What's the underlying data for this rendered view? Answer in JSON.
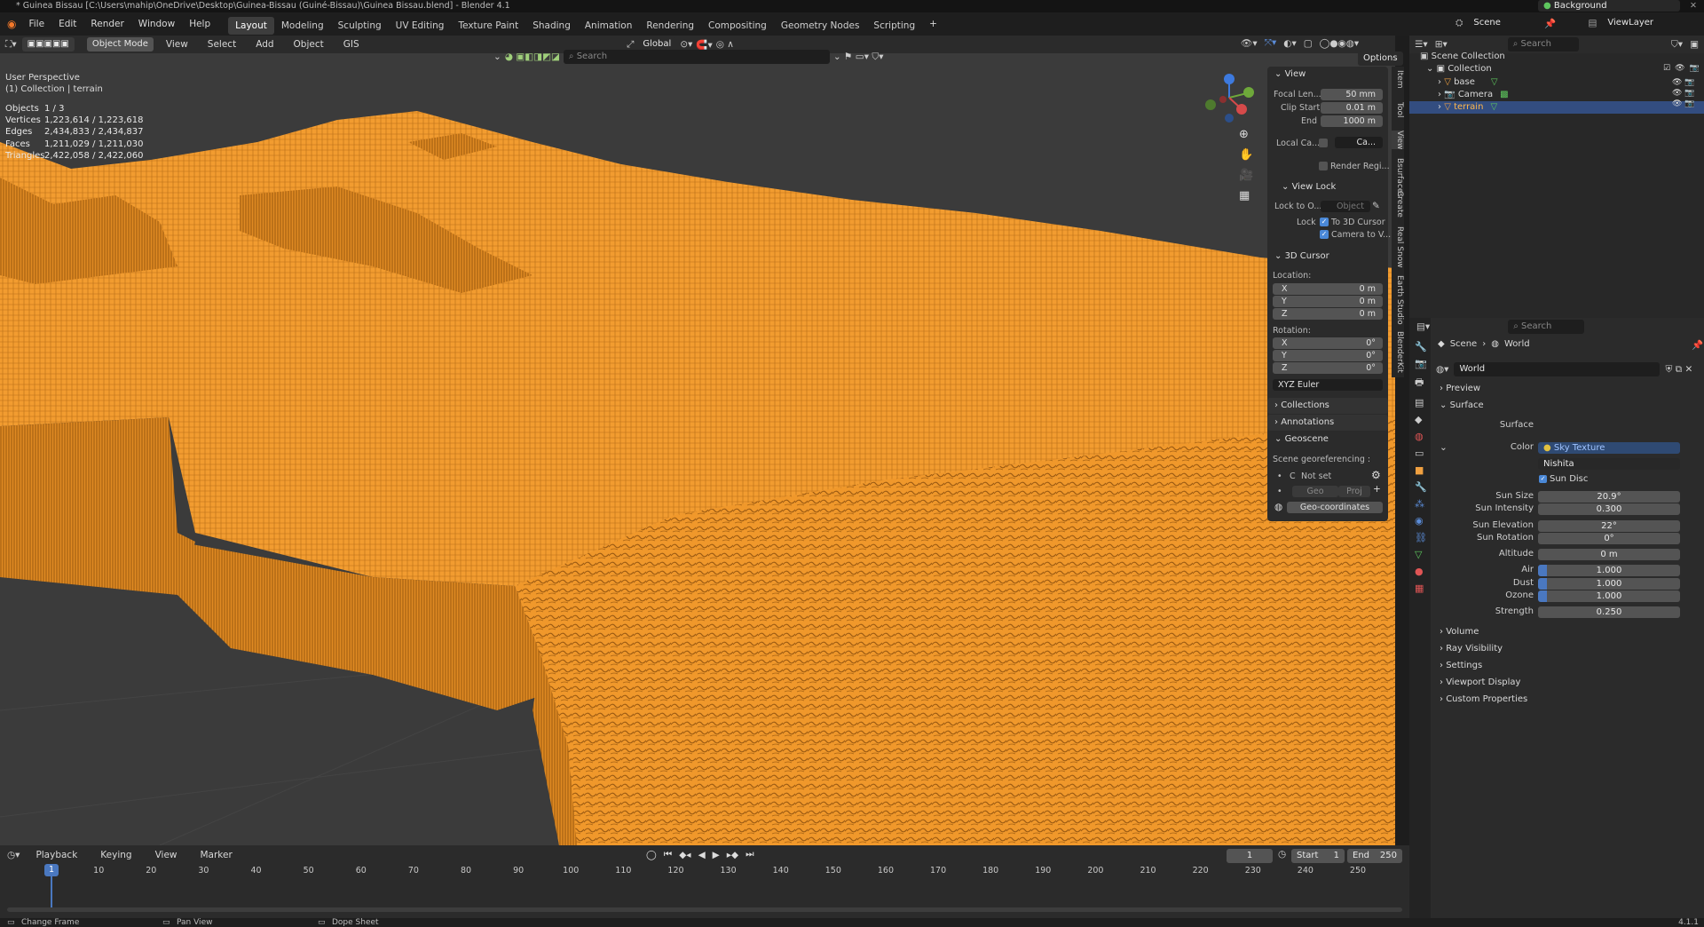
{
  "window": {
    "title": "* Guinea Bissau [C:\\Users\\mahip\\OneDrive\\Desktop\\Guinea-Bissau (Guiné-Bissau)\\Guinea Bissau.blend] - Blender 4.1"
  },
  "menu": [
    "File",
    "Edit",
    "Render",
    "Window",
    "Help"
  ],
  "workspaces": [
    "Layout",
    "Modeling",
    "Sculpting",
    "UV Editing",
    "Texture Paint",
    "Shading",
    "Animation",
    "Rendering",
    "Compositing",
    "Geometry Nodes",
    "Scripting"
  ],
  "topright": {
    "scene": "Scene",
    "viewlayer": "ViewLayer"
  },
  "viewport": {
    "mode": "Object Mode",
    "menus": [
      "View",
      "Select",
      "Add",
      "Object",
      "GIS"
    ],
    "orientation": "Global",
    "search_placeholder": "Search",
    "options": "Options",
    "perspective": "User Perspective",
    "collection": "(1) Collection | terrain",
    "stats": [
      {
        "label": "Objects",
        "value": "1 / 3"
      },
      {
        "label": "Vertices",
        "value": "1,223,614 / 1,223,618"
      },
      {
        "label": "Edges",
        "value": "2,434,833 / 2,434,837"
      },
      {
        "label": "Faces",
        "value": "1,211,029 / 1,211,030"
      },
      {
        "label": "Triangles",
        "value": "2,422,058 / 2,422,060"
      }
    ],
    "terrain_color": "#f19a2e"
  },
  "npanel": {
    "view_header": "View",
    "focal_label": "Focal Len...",
    "focal_value": "50 mm",
    "clip_start_label": "Clip Start",
    "clip_start_value": "0.01 m",
    "end_label": "End",
    "end_value": "1000 m",
    "local_camera_label": "Local Ca...",
    "local_camera_value": "Ca...",
    "render_region": "Render Regi...",
    "view_lock_header": "View Lock",
    "lock_to_label": "Lock to O...",
    "lock_to_placeholder": "Object",
    "lock_label": "Lock",
    "lock_cursor": "To 3D Cursor",
    "camera_to_view": "Camera to V...",
    "cursor_header": "3D Cursor",
    "location_label": "Location:",
    "loc": [
      {
        "axis": "X",
        "value": "0 m"
      },
      {
        "axis": "Y",
        "value": "0 m"
      },
      {
        "axis": "Z",
        "value": "0 m"
      }
    ],
    "rotation_label": "Rotation:",
    "rot": [
      {
        "axis": "X",
        "value": "0°"
      },
      {
        "axis": "Y",
        "value": "0°"
      },
      {
        "axis": "Z",
        "value": "0°"
      }
    ],
    "rotation_mode": "XYZ Euler",
    "collections": "Collections",
    "annotations": "Annotations",
    "geoscene": "Geoscene",
    "georef_label": "Scene georeferencing :",
    "crs_c": "C",
    "not_set": "Not set",
    "geo_btn": "Geo",
    "proj_btn": "Proj",
    "geocoords": "Geo-coordinates",
    "tabs": [
      "Item",
      "Tool",
      "View",
      "Bsurfaces",
      "Create",
      "Real Snow",
      "Earth Studio",
      "BlenderKit"
    ]
  },
  "outliner": {
    "search_placeholder": "Search",
    "scene_collection": "Scene Collection",
    "collection": "Collection",
    "items": [
      {
        "name": "base",
        "selected": false
      },
      {
        "name": "Camera",
        "selected": false
      },
      {
        "name": "terrain",
        "selected": true
      }
    ]
  },
  "properties": {
    "search_placeholder": "Search",
    "breadcrumb_scene": "Scene",
    "breadcrumb_world": "World",
    "world_name": "World",
    "preview": "Preview",
    "surface_section": "Surface",
    "surface_label": "Surface",
    "surface_value": "Background",
    "color_label": "Color",
    "color_value": "Sky Texture",
    "sky_type": "Nishita",
    "sun_disc": "Sun Disc",
    "fields": [
      {
        "label": "Sun Size",
        "value": "20.9°"
      },
      {
        "label": "Sun Intensity",
        "value": "0.300"
      },
      {
        "label": "Sun Elevation",
        "value": "22°"
      },
      {
        "label": "Sun Rotation",
        "value": "0°"
      },
      {
        "label": "Altitude",
        "value": "0 m"
      },
      {
        "label": "Air",
        "value": "1.000"
      },
      {
        "label": "Dust",
        "value": "1.000"
      },
      {
        "label": "Ozone",
        "value": "1.000"
      },
      {
        "label": "Strength",
        "value": "0.250"
      }
    ],
    "sections": [
      "Volume",
      "Ray Visibility",
      "Settings",
      "Viewport Display",
      "Custom Properties"
    ]
  },
  "timeline": {
    "menus": [
      "Playback",
      "Keying",
      "View",
      "Marker"
    ],
    "current_frame": "1",
    "start_label": "Start",
    "start": "1",
    "end_label": "End",
    "end": "250",
    "ticks": [
      "1",
      "10",
      "20",
      "30",
      "40",
      "50",
      "60",
      "70",
      "80",
      "90",
      "100",
      "110",
      "120",
      "130",
      "140",
      "150",
      "160",
      "170",
      "180",
      "190",
      "200",
      "210",
      "220",
      "230",
      "240",
      "250"
    ]
  },
  "status": {
    "left": "Change Frame",
    "mid": "Pan View",
    "right": "Dope Sheet",
    "version": "4.1.1"
  }
}
